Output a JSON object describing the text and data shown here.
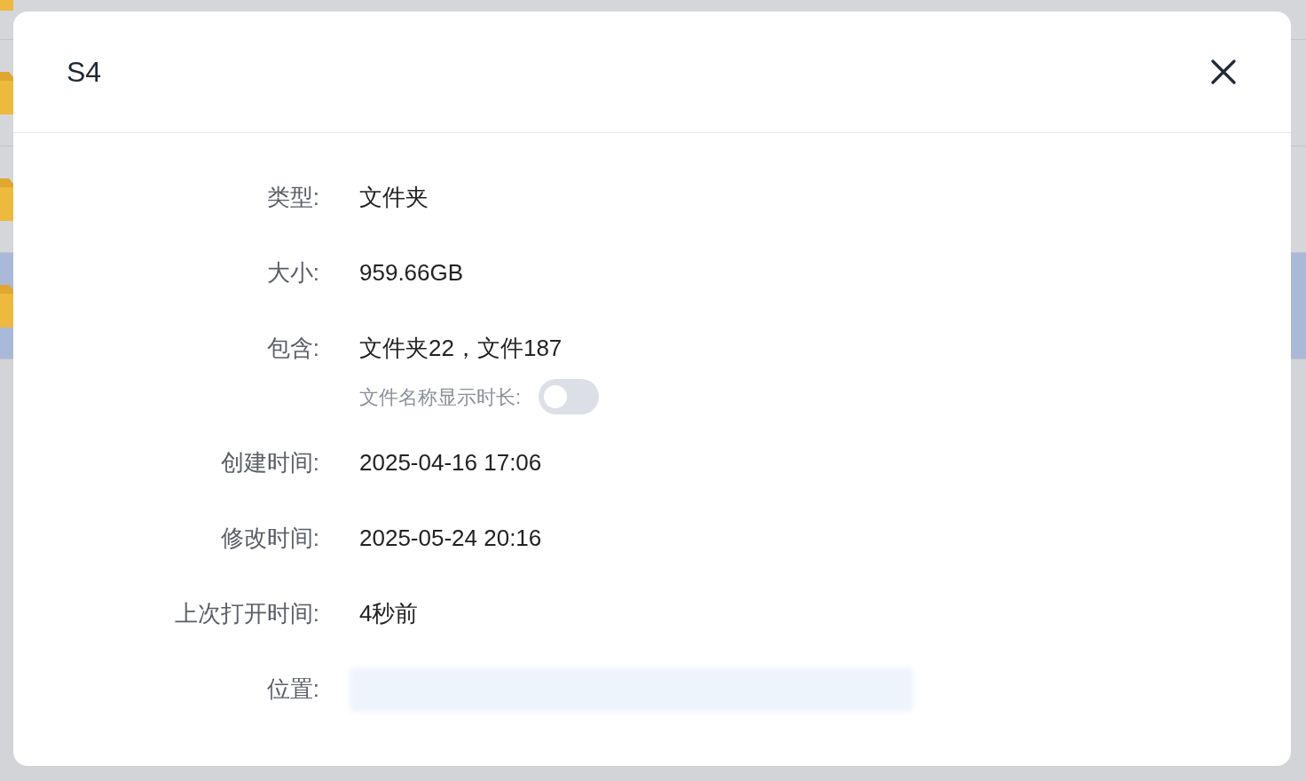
{
  "background_list": {
    "rows": [
      {
        "selected": false
      },
      {
        "selected": false
      },
      {
        "selected": false
      },
      {
        "selected": true
      }
    ]
  },
  "dialog": {
    "title": "S4",
    "fields": [
      {
        "kind": "text",
        "label": "类型:",
        "value": "文件夹"
      },
      {
        "kind": "text",
        "label": "大小:",
        "value": "959.66GB"
      },
      {
        "kind": "text",
        "label": "包含:",
        "value": "文件夹22，文件187"
      },
      {
        "kind": "toggle",
        "label": "文件名称显示时长:",
        "on": false
      },
      {
        "kind": "text",
        "label": "创建时间:",
        "value": "2025-04-16 17:06"
      },
      {
        "kind": "text",
        "label": "修改时间:",
        "value": "2025-05-24 20:16"
      },
      {
        "kind": "text",
        "label": "上次打开时间:",
        "value": "4秒前"
      },
      {
        "kind": "redacted",
        "label": "位置:"
      }
    ]
  }
}
